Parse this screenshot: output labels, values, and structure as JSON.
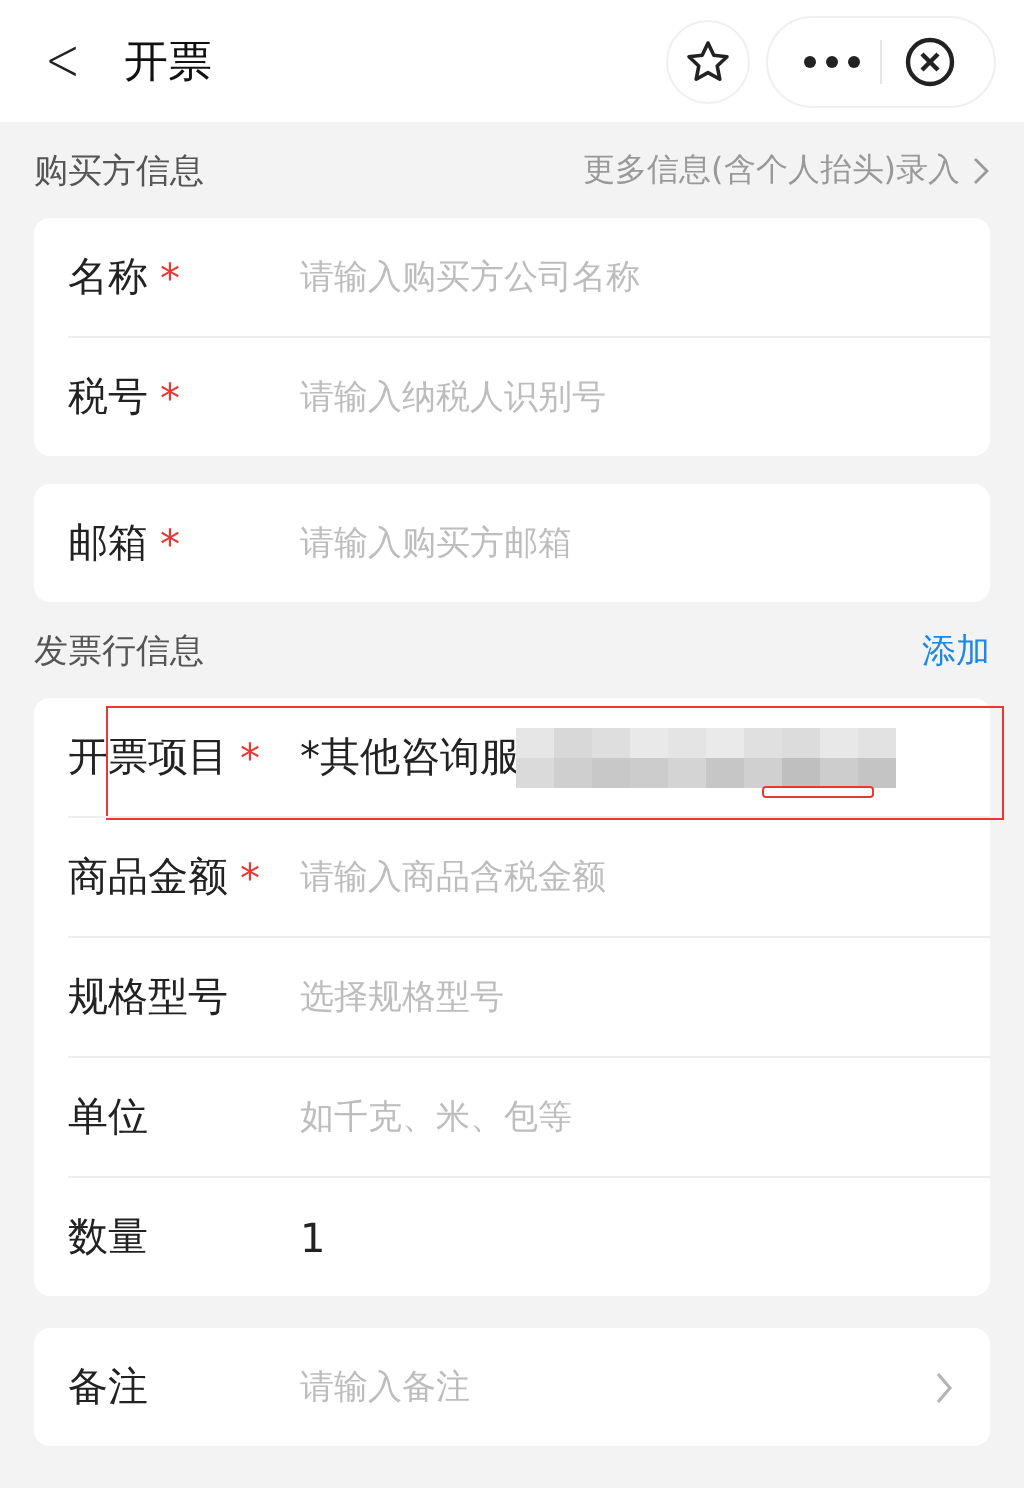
{
  "header": {
    "back": "<",
    "title": "开票"
  },
  "buyer_section": {
    "title": "购买方信息",
    "link": "更多信息(含个人抬头)录入"
  },
  "buyer_fields": [
    {
      "label": "名称",
      "required_mark": "*",
      "placeholder": "请输入购买方公司名称"
    },
    {
      "label": "税号",
      "required_mark": "*",
      "placeholder": "请输入纳税人识别号"
    }
  ],
  "email_fields": [
    {
      "label": "邮箱",
      "required_mark": "*",
      "placeholder": "请输入购买方邮箱"
    }
  ],
  "lines_section": {
    "title": "发票行信息",
    "action": "添加"
  },
  "line_fields": [
    {
      "label": "开票项目",
      "required_mark": "*",
      "value": "*其他咨询服",
      "redacted": true,
      "highlighted": true
    },
    {
      "label": "商品金额",
      "required_mark": "*",
      "placeholder": "请输入商品含税金额"
    },
    {
      "label": "规格型号",
      "placeholder": "选择规格型号"
    },
    {
      "label": "单位",
      "placeholder": "如千克、米、包等"
    },
    {
      "label": "数量",
      "value": "1"
    }
  ],
  "remark_fields": [
    {
      "label": "备注",
      "placeholder": "请输入备注",
      "chevron": true
    }
  ]
}
